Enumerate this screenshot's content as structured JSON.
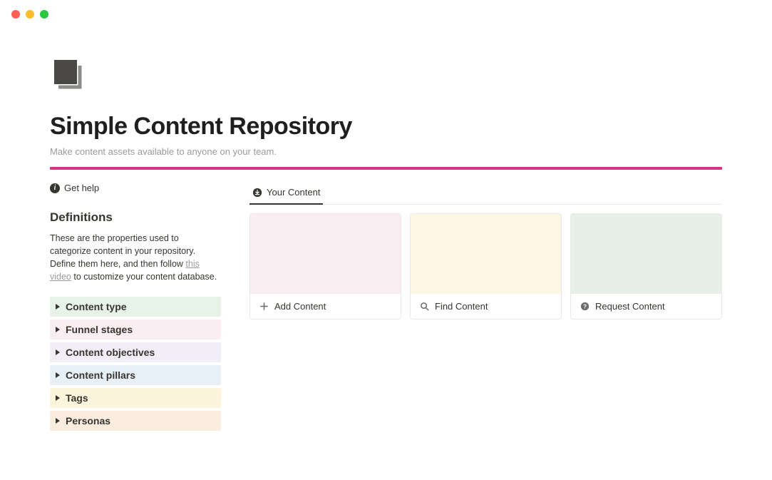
{
  "header": {
    "title": "Simple Content Repository",
    "subtitle": "Make content assets available to anyone on your team."
  },
  "getHelp": {
    "label": "Get help"
  },
  "definitions": {
    "heading": "Definitions",
    "desc_before": "These are the properties used to categorize content in your repository. Define them here, and then follow ",
    "desc_link": "this video",
    "desc_after": " to customize your content database.",
    "items": [
      {
        "label": "Content type"
      },
      {
        "label": "Funnel stages"
      },
      {
        "label": "Content objectives"
      },
      {
        "label": "Content pillars"
      },
      {
        "label": "Tags"
      },
      {
        "label": "Personas"
      }
    ]
  },
  "tabs": {
    "active": {
      "label": "Your Content"
    }
  },
  "cards": [
    {
      "label": "Add Content",
      "icon": "plus"
    },
    {
      "label": "Find Content",
      "icon": "search"
    },
    {
      "label": "Request Content",
      "icon": "question"
    }
  ]
}
